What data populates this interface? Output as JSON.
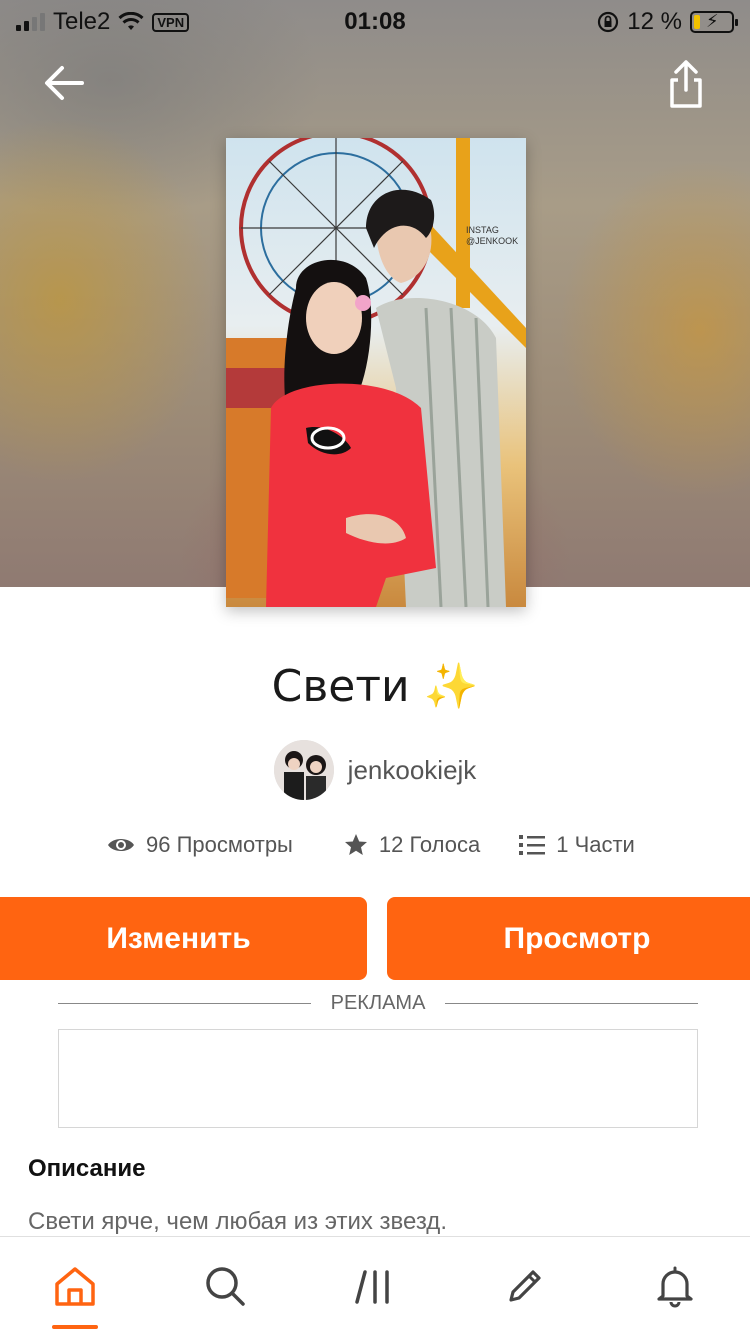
{
  "status_bar": {
    "carrier": "Tele2",
    "vpn_label": "VPN",
    "time": "01:08",
    "battery_percent": "12 %",
    "battery_level": 0.12
  },
  "story": {
    "title": "Свети ✨",
    "author": "jenkookiejk",
    "stats": {
      "views": "96 Просмотры",
      "votes": "12 Голоса",
      "parts": "1 Части"
    },
    "buttons": {
      "edit_label": "Изменить",
      "view_label": "Просмотр"
    },
    "ad_label": "РЕКЛАМА",
    "description_heading": "Описание",
    "description_text": "Свети ярче, чем любая из этих звезд."
  },
  "cover_watermark": "INSTAG @JENKOOK",
  "nav": {
    "items": [
      "home-icon",
      "search-icon",
      "library-icon",
      "write-icon",
      "notifications-icon"
    ],
    "active": "home-icon"
  },
  "colors": {
    "accent": "#ff6411"
  }
}
